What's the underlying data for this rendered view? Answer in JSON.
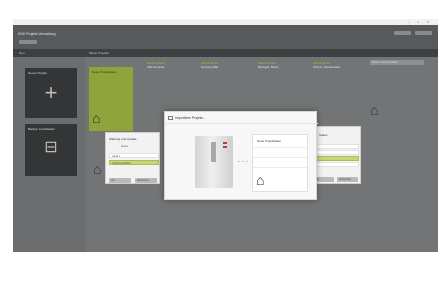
{
  "window": {
    "title": "",
    "controls": [
      "–",
      "□",
      "✕"
    ]
  },
  "header": {
    "app_title": "KNX Projekt-Verwaltung"
  },
  "subbar": {
    "left_label": "Neu",
    "right_label": "Meine Projekte"
  },
  "sidebar": {
    "tiles": [
      {
        "label": "Neues Projekt",
        "icon": "plus-icon",
        "glyph": "+"
      },
      {
        "label": "Backup zurückladen",
        "icon": "backup-icon",
        "glyph": "⊟"
      }
    ]
  },
  "projects": [
    {
      "label": "Neue Projektdatei",
      "pre": ""
    },
    {
      "label": "Villa Zentrale",
      "pre": "Aktuelle Version"
    },
    {
      "label": "Heizung Bäd",
      "pre": "Aktuelle Version"
    },
    {
      "label": "Bürogeb. Berlin",
      "pre": "Aktuelle Version"
    },
    {
      "label": "Wohnh. Musterstadt",
      "pre": "Aktuelle Version"
    }
  ],
  "search": {
    "placeholder": "Suchen nach Projekten"
  },
  "left_dialog": {
    "title": "Wartung und Update",
    "subtitle": "Status",
    "rows": [
      "Gerät 1",
      "Gerät auswählen"
    ],
    "buttons": [
      "OK",
      "Abbrechen"
    ]
  },
  "right_dialog": {
    "title": "Status",
    "rows": [
      "",
      "",
      "",
      ""
    ],
    "buttons": [
      "OK",
      "Abbrechen"
    ]
  },
  "center_dialog": {
    "title": "Importiere Projekt...",
    "target_title": "Neue Projektdatei",
    "arrow": "· · · →"
  },
  "colors": {
    "accent": "#8fa33a",
    "overlay": "#6a6c6d",
    "tile": "#343536"
  }
}
